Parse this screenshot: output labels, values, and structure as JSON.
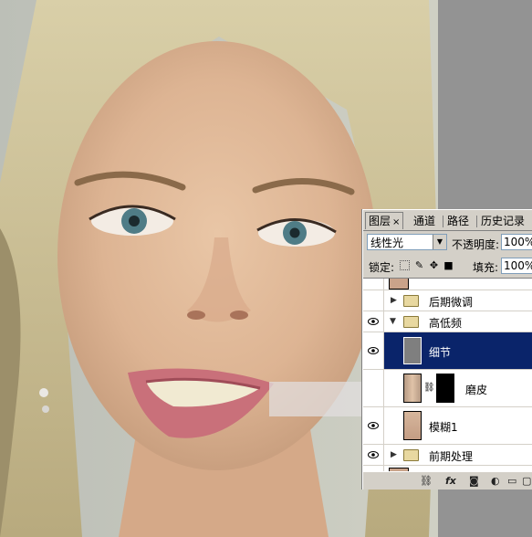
{
  "panel": {
    "tabs": [
      {
        "label": "图层",
        "close": "×",
        "active": true
      },
      {
        "label": "通道"
      },
      {
        "label": "路径"
      },
      {
        "label": "历史记录"
      }
    ],
    "blend_mode": "线性光",
    "opacity_label": "不透明度:",
    "opacity_value": "100%",
    "lock_label": "锁定:",
    "fill_label": "填充:",
    "fill_value": "100%",
    "layers": [
      {
        "name": "后期微调",
        "type": "group",
        "visible": false,
        "expanded": false
      },
      {
        "name": "高低频",
        "type": "group",
        "visible": true,
        "expanded": true
      },
      {
        "name": "细节",
        "type": "layer",
        "visible": true,
        "selected": true
      },
      {
        "name": "磨皮",
        "type": "layer-with-mask",
        "visible": false
      },
      {
        "name": "模糊1",
        "type": "layer",
        "visible": true
      },
      {
        "name": "前期处理",
        "type": "group",
        "visible": true,
        "expanded": false
      }
    ],
    "bottom_icons": [
      "link-icon",
      "fx-icon",
      "mask-icon",
      "adjustment-icon",
      "folder-icon",
      "new-layer-icon"
    ]
  },
  "colors": {
    "panel_bg": "#d4d0c8",
    "selection": "#0a246a",
    "canvas_bg": "#939393"
  }
}
